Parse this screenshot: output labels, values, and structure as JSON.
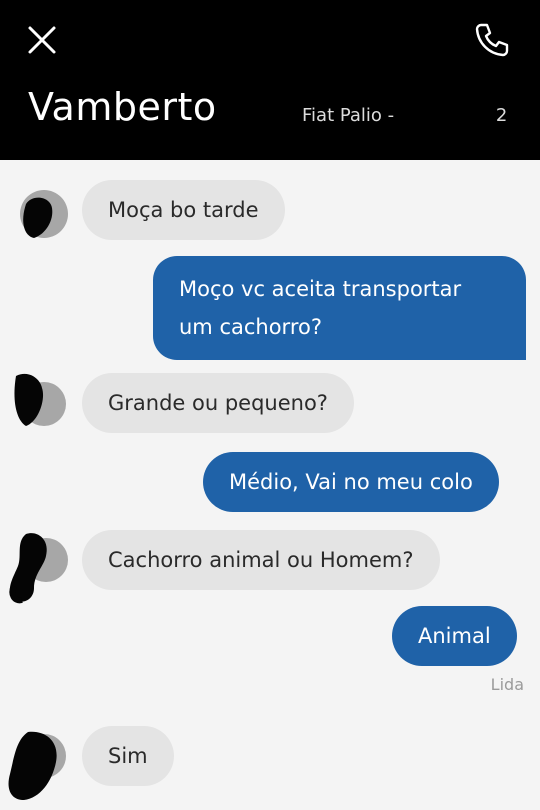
{
  "header": {
    "title": "Vamberto",
    "vehicle_prefix": "Fiat Palio -",
    "vehicle_suffix": "2",
    "close_icon": "close-icon",
    "phone_icon": "phone-icon",
    "background": "#000000"
  },
  "messages": [
    {
      "from": "driver",
      "text": "Moça bo tarde"
    },
    {
      "from": "me",
      "text": "Moço vc aceita transportar um cachorro?"
    },
    {
      "from": "driver",
      "text": "Grande ou pequeno?"
    },
    {
      "from": "me",
      "text": "Médio, Vai no meu colo"
    },
    {
      "from": "driver",
      "text": "Cachorro animal ou Homem?"
    },
    {
      "from": "me",
      "text": "Animal"
    },
    {
      "from": "driver",
      "text": "Sim"
    }
  ],
  "read_receipt": "Lida",
  "colors": {
    "outgoing_bubble": "#1f62a8",
    "incoming_bubble": "#e4e4e4",
    "chat_background": "#f4f4f4"
  }
}
